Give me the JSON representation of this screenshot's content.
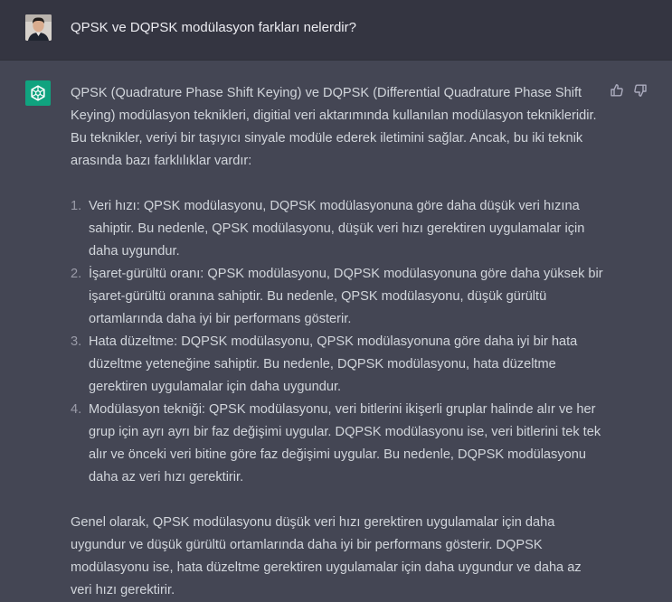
{
  "user_message": {
    "text": "QPSK ve DQPSK modülasyon farkları nelerdir?"
  },
  "assistant_message": {
    "intro": "QPSK (Quadrature Phase Shift Keying) ve DQPSK (Differential Quadrature Phase Shift Keying) modülasyon teknikleri, digitial veri aktarımında kullanılan modülasyon teknikleridir. Bu teknikler, veriyi bir taşıyıcı sinyale modüle ederek iletimini sağlar. Ancak, bu iki teknik arasında bazı farklılıklar vardır:",
    "list": [
      {
        "number": "1.",
        "text": "Veri hızı: QPSK modülasyonu, DQPSK modülasyonuna göre daha düşük veri hızına sahiptir. Bu nedenle, QPSK modülasyonu, düşük veri hızı gerektiren uygulamalar için daha uygundur."
      },
      {
        "number": "2.",
        "text": "İşaret-gürültü oranı: QPSK modülasyonu, DQPSK modülasyonuna göre daha yüksek bir işaret-gürültü oranına sahiptir. Bu nedenle, QPSK modülasyonu, düşük gürültü ortamlarında daha iyi bir performans gösterir."
      },
      {
        "number": "3.",
        "text": "Hata düzeltme: DQPSK modülasyonu, QPSK modülasyonuna göre daha iyi bir hata düzeltme yeteneğine sahiptir. Bu nedenle, DQPSK modülasyonu, hata düzeltme gerektiren uygulamalar için daha uygundur."
      },
      {
        "number": "4.",
        "text": "Modülasyon tekniği: QPSK modülasyonu, veri bitlerini ikişerli gruplar halinde alır ve her grup için ayrı ayrı bir faz değişimi uygular. DQPSK modülasyonu ise, veri bitlerini tek tek alır ve önceki veri bitine göre faz değişimi uygular. Bu nedenle, DQPSK modülasyonu daha az veri hızı gerektirir."
      }
    ],
    "conclusion": "Genel olarak, QPSK modülasyonu düşük veri hızı gerektiren uygulamalar için daha uygundur ve düşük gürültü ortamlarında daha iyi bir performans gösterir. DQPSK modülasyonu ise, hata düzeltme gerektiren uygulamalar için daha uygundur ve daha az veri hızı gerektirir."
  },
  "icons": {
    "user_avatar": "user-avatar-photo",
    "assistant_avatar": "openai-logo-icon",
    "feedback_up": "thumbs-up-icon",
    "feedback_down": "thumbs-down-icon"
  },
  "colors": {
    "user_row_bg": "#343541",
    "assistant_row_bg": "#444654",
    "text": "#d1d5db",
    "brand": "#10a37f"
  }
}
